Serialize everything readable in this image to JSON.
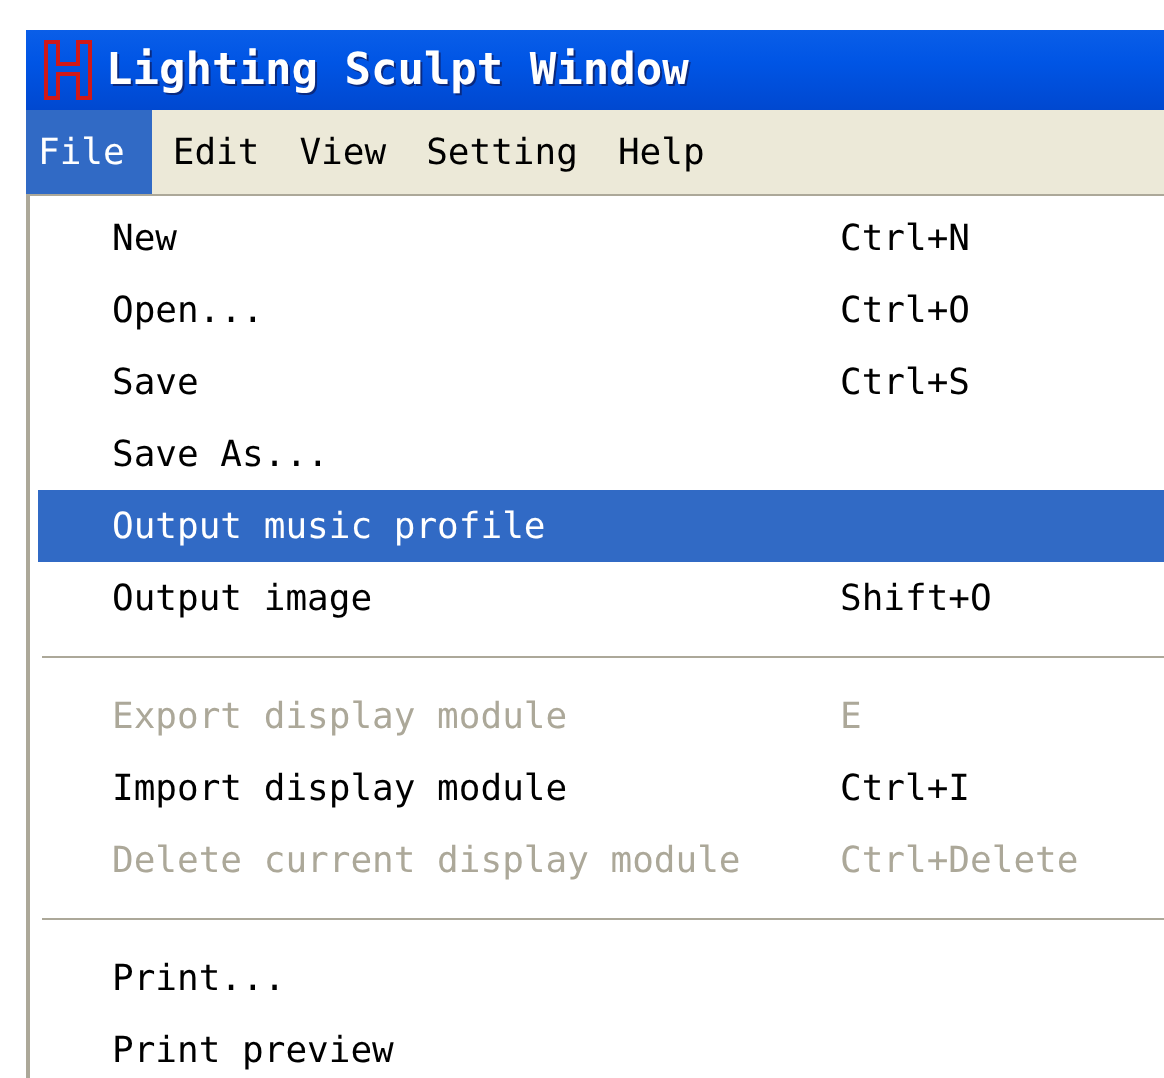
{
  "window": {
    "title": "Lighting Sculpt Window"
  },
  "menubar": [
    {
      "label": "File",
      "selected": true
    },
    {
      "label": "Edit",
      "selected": false
    },
    {
      "label": "View",
      "selected": false
    },
    {
      "label": "Setting",
      "selected": false
    },
    {
      "label": "Help",
      "selected": false
    }
  ],
  "menu": [
    {
      "kind": "item",
      "label": "New",
      "shortcut": "Ctrl+N",
      "selected": false,
      "disabled": false
    },
    {
      "kind": "item",
      "label": "Open...",
      "shortcut": "Ctrl+O",
      "selected": false,
      "disabled": false
    },
    {
      "kind": "item",
      "label": "Save",
      "shortcut": "Ctrl+S",
      "selected": false,
      "disabled": false
    },
    {
      "kind": "item",
      "label": "Save As...",
      "selected": false,
      "disabled": false
    },
    {
      "kind": "item",
      "label": "Output music profile",
      "selected": true,
      "disabled": false
    },
    {
      "kind": "item",
      "label": "Output image",
      "shortcut": "Shift+O",
      "selected": false,
      "disabled": false
    },
    {
      "kind": "separator"
    },
    {
      "kind": "item",
      "label": "Export display module",
      "shortcut": "E",
      "selected": false,
      "disabled": true
    },
    {
      "kind": "item",
      "label": "Import display module",
      "shortcut": "Ctrl+I",
      "selected": false,
      "disabled": false
    },
    {
      "kind": "item",
      "label": "Delete current display module",
      "shortcut": "Ctrl+Delete",
      "selected": false,
      "disabled": true
    },
    {
      "kind": "separator"
    },
    {
      "kind": "item",
      "label": "Print...",
      "selected": false,
      "disabled": false
    },
    {
      "kind": "item",
      "label": "Print preview",
      "selected": false,
      "disabled": false
    }
  ]
}
